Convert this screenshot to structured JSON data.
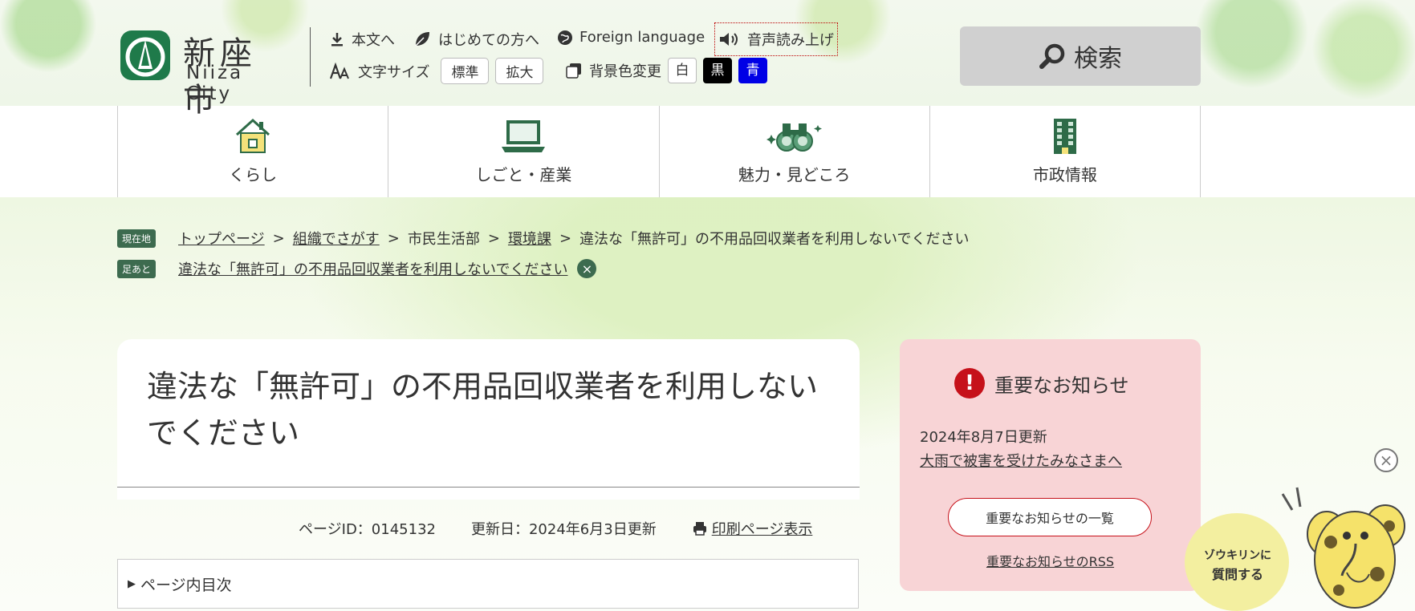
{
  "header": {
    "logo_jp": "新座市",
    "logo_en": "Niiza City",
    "tools": {
      "skip": "本文へ",
      "beginners": "はじめての方へ",
      "foreign": "Foreign language",
      "voice": "音声読み上げ",
      "font_size": "文字サイズ",
      "font_standard": "標準",
      "font_large": "拡大",
      "bg_color": "背景色変更",
      "bg_white": "白",
      "bg_black": "黒",
      "bg_blue": "青"
    },
    "search_label": "検索"
  },
  "gnav": {
    "items": [
      {
        "label": "くらし",
        "icon": "house-icon"
      },
      {
        "label": "しごと・産業",
        "icon": "laptop-icon"
      },
      {
        "label": "魅力・見どころ",
        "icon": "binoculars-icon"
      },
      {
        "label": "市政情報",
        "icon": "building-icon"
      }
    ]
  },
  "breadcrumb": {
    "tag": "現在地",
    "items": [
      "トップページ",
      "組織でさがす",
      "市民生活部",
      "環境課",
      "違法な「無許可」の不用品回収業者を利用しないでください"
    ],
    "separator": ">"
  },
  "footprint": {
    "tag": "足あと",
    "link": "違法な「無許可」の不用品回収業者を利用しないでください",
    "close": "×"
  },
  "article": {
    "title": "違法な「無許可」の不用品回収業者を利用しないでください",
    "page_id": "ページID：0145132",
    "updated": "更新日：2024年6月3日更新",
    "print": "印刷ページ表示",
    "toc": "ページ内目次"
  },
  "notice": {
    "heading": "重要なお知らせ",
    "date": "2024年8月7日更新",
    "link": "大雨で被害を受けたみなさまへ",
    "list_button": "重要なお知らせの一覧",
    "rss": "重要なお知らせのRSS"
  },
  "chatbot": {
    "label_line1": "ゾウキリンに",
    "label_line2": "質問する",
    "close": "×"
  },
  "colors": {
    "tag_green": "#3d6b4f",
    "notice_bg": "#f8d4d6",
    "alert_red": "#c6111a",
    "search_bg": "#d0d0d0",
    "bg_blue": "#0000e6"
  }
}
